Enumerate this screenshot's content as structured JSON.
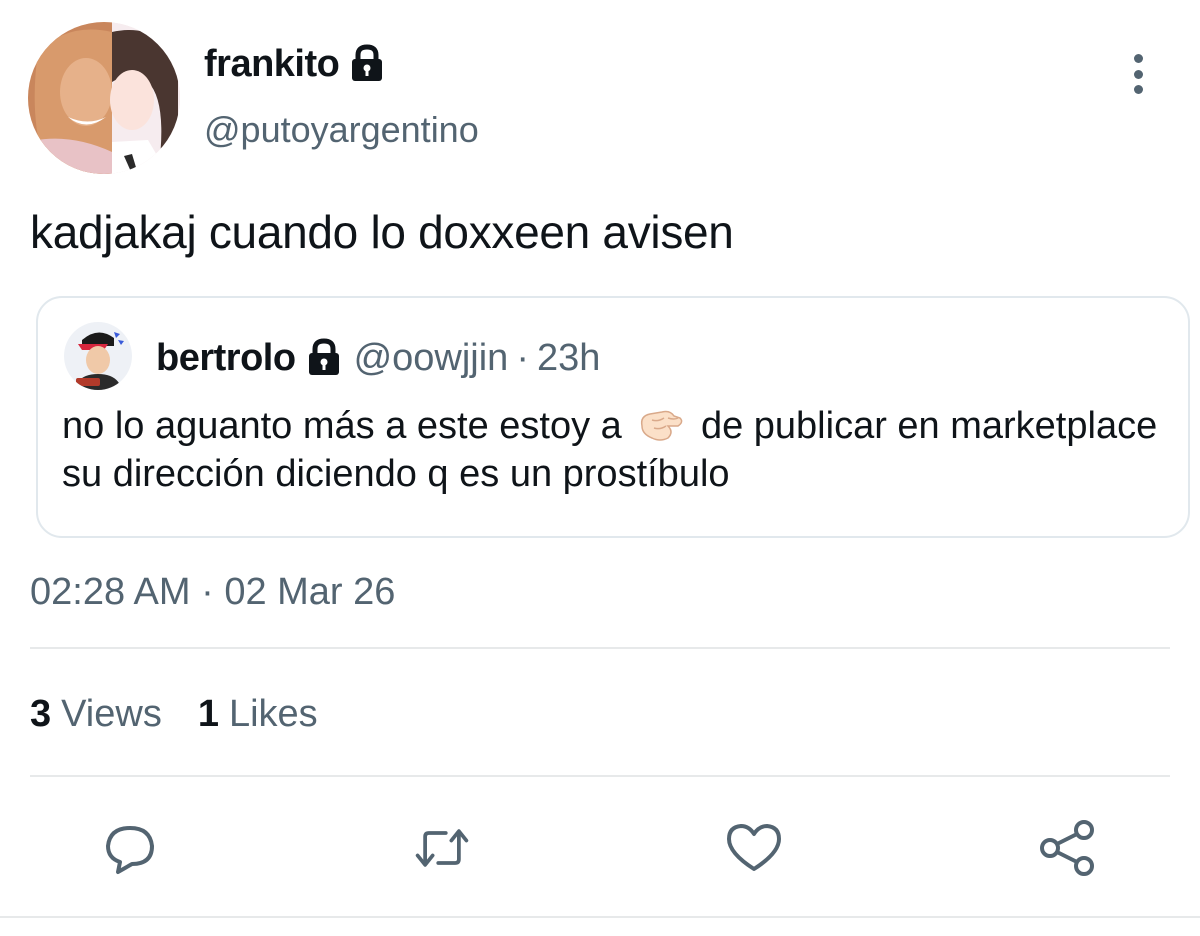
{
  "author": {
    "display_name": "frankito",
    "handle": "@putoyargentino",
    "protected_icon": "lock-icon"
  },
  "tweet": {
    "text": "kadjakaj cuando lo doxxeen avisen",
    "timestamp": "02:28 AM · 02 Mar 26"
  },
  "quoted_tweet": {
    "display_name": "bertrolo",
    "handle": "@oowjjin",
    "separator": "·",
    "time": "23h",
    "text_before_emoji": "no lo aguanto más a este estoy a",
    "emoji_icon": "pinching-fist-icon",
    "text_after_emoji": "de publicar en marketplace su dirección diciendo q es un prostíbulo"
  },
  "stats": {
    "views_count": "3",
    "views_label": "Views",
    "likes_count": "1",
    "likes_label": "Likes"
  },
  "actions": [
    "reply-icon",
    "retweet-icon",
    "like-icon",
    "share-icon"
  ],
  "colors": {
    "text_primary": "#0f1419",
    "text_secondary": "#536471",
    "border": "#e1e8ed"
  }
}
